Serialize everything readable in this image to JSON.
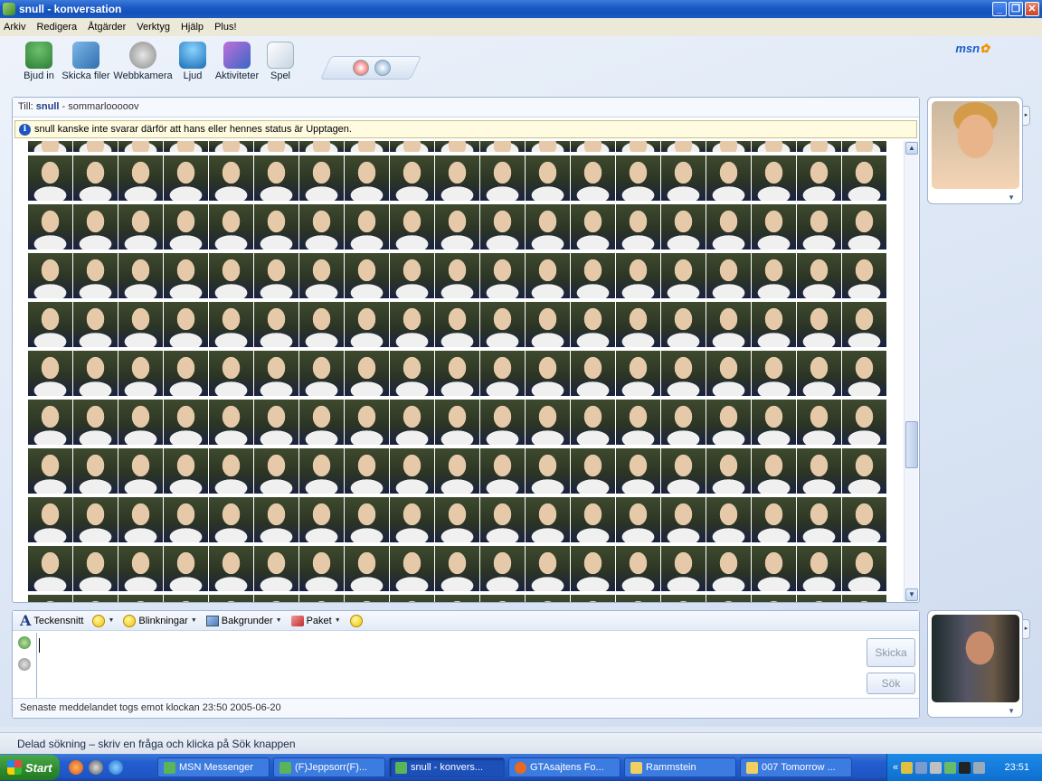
{
  "window": {
    "title": "snull - konversation"
  },
  "menu": [
    "Arkiv",
    "Redigera",
    "Åtgärder",
    "Verktyg",
    "Hjälp",
    "Plus!"
  ],
  "toolbar": [
    {
      "label": "Bjud in",
      "icon": "invite-icon"
    },
    {
      "label": "Skicka filer",
      "icon": "send-files-icon"
    },
    {
      "label": "Webbkamera",
      "icon": "webcam-icon"
    },
    {
      "label": "Ljud",
      "icon": "audio-icon"
    },
    {
      "label": "Aktiviteter",
      "icon": "activities-icon"
    },
    {
      "label": "Spel",
      "icon": "games-icon"
    }
  ],
  "logo": "msn",
  "conversation": {
    "to_label": "Till:",
    "to_name": "snull",
    "to_message": "- sommarlooooov",
    "status_notice": "snull kanske inte svarar därför att hans eller hennes status är Upptagen.",
    "emoticon_rows": 10,
    "emoticons_per_row": 19
  },
  "compose": {
    "font_label": "Teckensnitt",
    "winks_label": "Blinkningar",
    "backgrounds_label": "Bakgrunder",
    "packs_label": "Paket",
    "send_label": "Skicka",
    "search_label": "Sök",
    "last_message": "Senaste meddelandet togs emot klockan 23:50 2005-06-20"
  },
  "search_hint": "Delad sökning – skriv en fråga och klicka på Sök knappen",
  "taskbar": {
    "start_label": "Start",
    "tasks": [
      {
        "label": "MSN Messenger",
        "active": false
      },
      {
        "label": "(F)Jeppsorr(F)...",
        "active": false
      },
      {
        "label": "snull - konvers...",
        "active": true
      },
      {
        "label": "GTAsajtens Fo...",
        "active": false
      },
      {
        "label": "Rammstein",
        "active": false
      },
      {
        "label": "007 Tomorrow ...",
        "active": false
      }
    ],
    "tray_arrow": "«",
    "clock": "23:51"
  },
  "colors": {
    "titlebar": "#1452b8",
    "accent": "#1a5ccc",
    "notice_bg": "#fffbe0",
    "taskbar": "#245ed0"
  }
}
